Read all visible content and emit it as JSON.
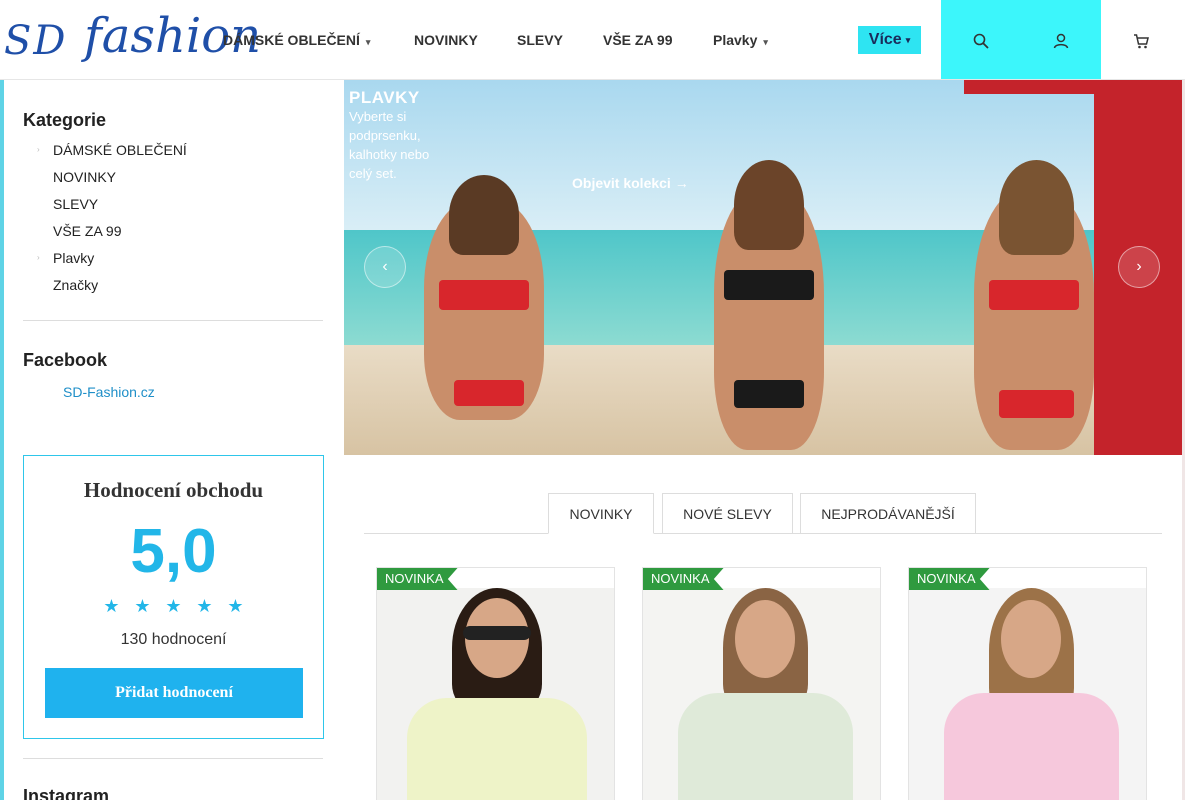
{
  "header": {
    "logo_sd": "SD",
    "logo_fashion": "fashion",
    "nav": [
      {
        "label": "DÁMSKÉ OBLEČENÍ",
        "has_caret": true
      },
      {
        "label": "NOVINKY",
        "has_caret": false
      },
      {
        "label": "SLEVY",
        "has_caret": false
      },
      {
        "label": "VŠE ZA 99",
        "has_caret": false
      },
      {
        "label": "Plavky",
        "has_caret": true
      }
    ],
    "more_label": "Více",
    "icons": [
      "search-icon",
      "user-icon",
      "cart-icon"
    ],
    "accent_color": "#3cf6fb"
  },
  "sidebar": {
    "categories_title": "Kategorie",
    "categories": [
      {
        "label": "DÁMSKÉ OBLEČENÍ",
        "has_children": true
      },
      {
        "label": "NOVINKY",
        "has_children": false
      },
      {
        "label": "SLEVY",
        "has_children": false
      },
      {
        "label": "VŠE ZA 99",
        "has_children": false
      },
      {
        "label": "Plavky",
        "has_children": true
      },
      {
        "label": "Značky",
        "has_children": false
      }
    ],
    "facebook_title": "Facebook",
    "facebook_link": "SD-Fashion.cz",
    "instagram_title": "Instagram"
  },
  "rating": {
    "title": "Hodnocení obchodu",
    "score": "5,0",
    "stars": 5,
    "count_text": "130 hodnocení",
    "add_button": "Přidat hodnocení",
    "accent_color": "#22b6e8"
  },
  "banner": {
    "heading": "PLAVKY",
    "text_lines": [
      "Vyberte si",
      "podprsenku,",
      "kalhotky nebo",
      "celý set."
    ],
    "cta": "Objevit kolekci →"
  },
  "tabs": [
    {
      "label": "NOVINKY",
      "active": true
    },
    {
      "label": "NOVÉ SLEVY",
      "active": false
    },
    {
      "label": "NEJPRODÁVANĚJŠÍ",
      "active": false
    }
  ],
  "products": [
    {
      "badge": "NOVINKA",
      "shirt_color": "#eef3c8"
    },
    {
      "badge": "NOVINKA",
      "shirt_color": "#dfead9"
    },
    {
      "badge": "NOVINKA",
      "shirt_color": "#f6c8dc"
    }
  ]
}
